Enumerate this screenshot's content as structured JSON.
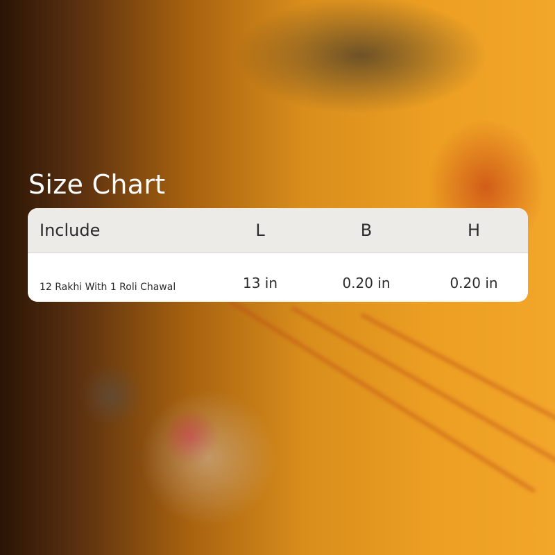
{
  "title": "Size Chart",
  "table": {
    "headers": [
      "Include",
      "L",
      "B",
      "H"
    ],
    "rows": [
      [
        "12 Rakhi With 1 Roli Chawal",
        "13 in",
        "0.20 in",
        "0.20 in"
      ]
    ]
  }
}
